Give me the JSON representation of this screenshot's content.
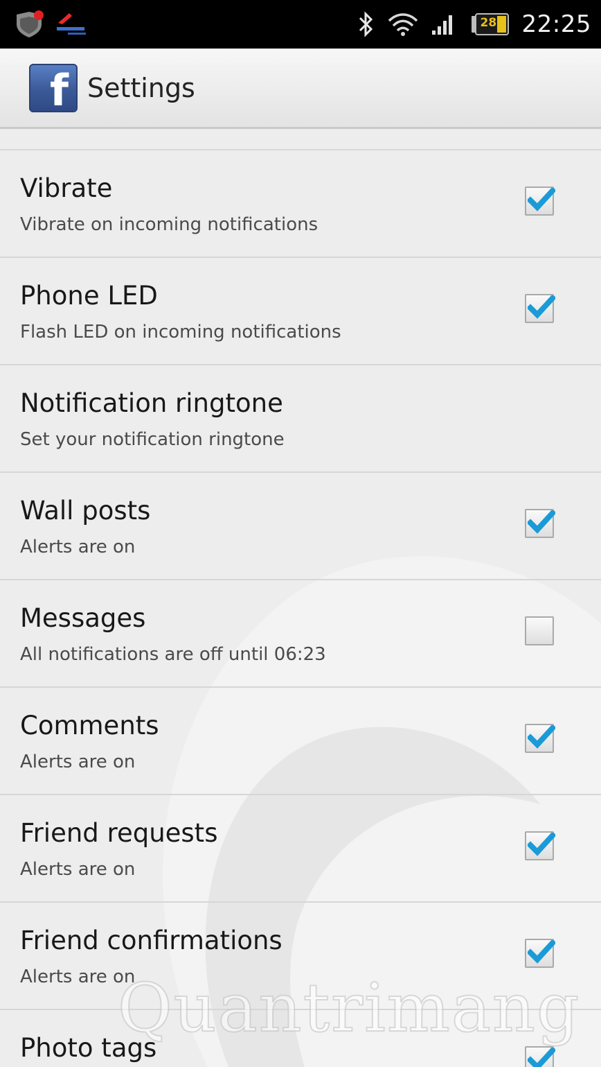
{
  "status_bar": {
    "time": "22:25",
    "battery": "28"
  },
  "header": {
    "logo_letter": "f",
    "title": "Settings"
  },
  "settings": [
    {
      "title": "Vibrate",
      "summary": "Vibrate on incoming notifications",
      "has_checkbox": true,
      "checked": true
    },
    {
      "title": "Phone LED",
      "summary": "Flash LED on incoming notifications",
      "has_checkbox": true,
      "checked": true
    },
    {
      "title": "Notification ringtone",
      "summary": "Set your notification ringtone",
      "has_checkbox": false,
      "checked": false
    },
    {
      "title": "Wall posts",
      "summary": "Alerts are on",
      "has_checkbox": true,
      "checked": true
    },
    {
      "title": "Messages",
      "summary": "All notifications are off until 06:23",
      "has_checkbox": true,
      "checked": false
    },
    {
      "title": "Comments",
      "summary": "Alerts are on",
      "has_checkbox": true,
      "checked": true
    },
    {
      "title": "Friend requests",
      "summary": "Alerts are on",
      "has_checkbox": true,
      "checked": true
    },
    {
      "title": "Friend confirmations",
      "summary": "Alerts are on",
      "has_checkbox": true,
      "checked": true
    },
    {
      "title": "Photo tags",
      "summary": "",
      "has_checkbox": true,
      "checked": true
    }
  ],
  "watermark": "Quantrimang",
  "colors": {
    "check_accent": "#1a9bd7",
    "facebook_blue": "#3b5998"
  },
  "icons": [
    "shield-icon",
    "app-notification-icon",
    "bluetooth-icon",
    "wifi-icon",
    "signal-icon",
    "battery-icon",
    "facebook-logo-icon",
    "checkmark-icon"
  ]
}
